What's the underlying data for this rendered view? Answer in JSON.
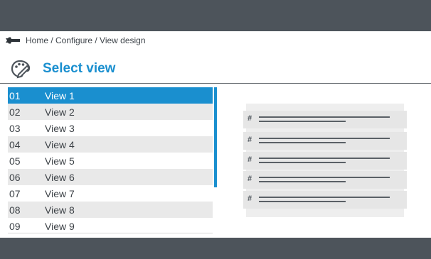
{
  "breadcrumb": {
    "icon": "wrench-icon",
    "path": "Home / Configure / View design"
  },
  "header": {
    "icon": "view-design-icon",
    "title": "Select view",
    "accent_color": "#1a8fcf"
  },
  "views": [
    {
      "num": "01",
      "label": "View 1",
      "selected": true
    },
    {
      "num": "02",
      "label": "View 2",
      "selected": false
    },
    {
      "num": "03",
      "label": "View 3",
      "selected": false
    },
    {
      "num": "04",
      "label": "View 4",
      "selected": false
    },
    {
      "num": "05",
      "label": "View 5",
      "selected": false
    },
    {
      "num": "06",
      "label": "View 6",
      "selected": false
    },
    {
      "num": "07",
      "label": "View 7",
      "selected": false
    },
    {
      "num": "08",
      "label": "View 8",
      "selected": false
    },
    {
      "num": "09",
      "label": "View 9",
      "selected": false
    }
  ],
  "preview": {
    "rows": [
      {
        "symbol": "#"
      },
      {
        "symbol": "#"
      },
      {
        "symbol": "#"
      },
      {
        "symbol": "#"
      },
      {
        "symbol": "#"
      }
    ]
  }
}
